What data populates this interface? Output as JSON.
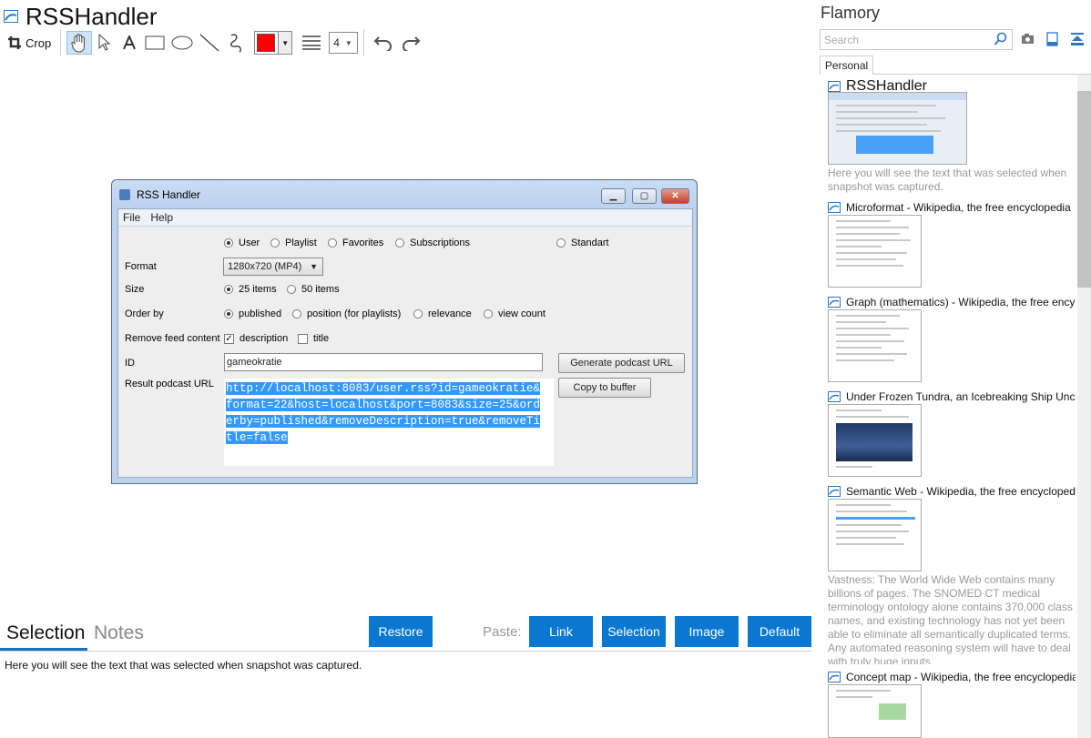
{
  "title": "RSSHandler",
  "toolbar": {
    "crop_label": "Crop",
    "line_width": "4",
    "color": "#ff0000"
  },
  "dialog": {
    "title": "RSS Handler",
    "menu": [
      "File",
      "Help"
    ],
    "type_options": [
      "User",
      "Playlist",
      "Favorites",
      "Subscriptions",
      "Standart"
    ],
    "format_label": "Format",
    "format_value": "1280x720 (MP4)",
    "size_label": "Size",
    "size_options": [
      "25 items",
      "50 items"
    ],
    "order_label": "Order by",
    "order_options": [
      "published",
      "position (for playlists)",
      "relevance",
      "view count"
    ],
    "remove_label": "Remove feed content",
    "remove_options": [
      "description",
      "title"
    ],
    "id_label": "ID",
    "id_value": "gameokratie",
    "generate_button": "Generate podcast URL",
    "result_label": "Result podcast URL",
    "copy_button": "Copy to buffer",
    "result_value": "http://localhost:8083/user.rss?id=gameokratie&format=22&host=localhost&port=8083&size=25&orderby=published&removeDescription=true&removeTitle=false"
  },
  "bottom": {
    "tabs": [
      "Selection",
      "Notes"
    ],
    "restore": "Restore",
    "paste_label": "Paste:",
    "paste_buttons": [
      "Link",
      "Selection",
      "Image",
      "Default"
    ],
    "selection_text": "Here you will see the text that was selected when snapshot was captured."
  },
  "panel": {
    "title": "Flamory",
    "search_placeholder": "Search",
    "tab": "Personal",
    "snapshots": [
      {
        "title": "RSSHandler",
        "desc": "Here you will see the text that was selected when snapshot was captured."
      },
      {
        "title": "Microformat - Wikipedia, the free encyclopedia"
      },
      {
        "title": "Graph (mathematics) - Wikipedia, the free encyclopedia"
      },
      {
        "title": "Under Frozen Tundra, an Icebreaking Ship Uncovers"
      },
      {
        "title": "Semantic Web - Wikipedia, the free encyclopedia",
        "desc": "Vastness: The World Wide Web contains many billions of pages. The SNOMED CT medical terminology ontology alone contains 370,000 class names, and existing technology has not yet been able to eliminate all semantically duplicated terms. Any automated reasoning system will have to deal with truly huge inputs."
      },
      {
        "title": "Concept map - Wikipedia, the free encyclopedia"
      }
    ]
  },
  "colors": {
    "accent": "#0a78d1",
    "selection": "#3399ff"
  }
}
